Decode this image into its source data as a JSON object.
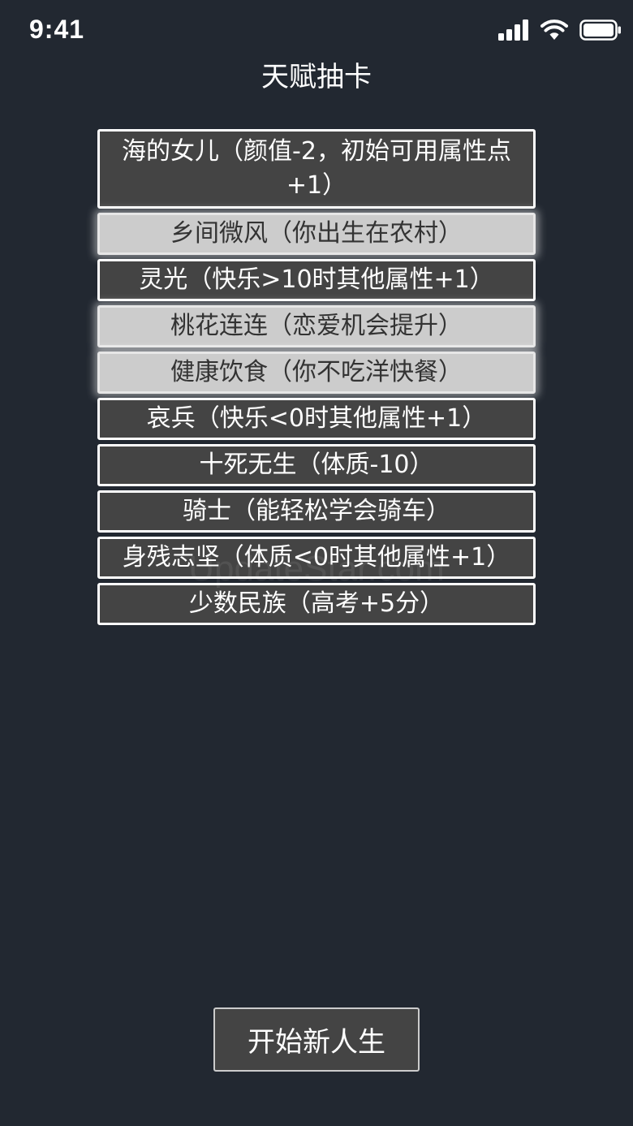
{
  "status_bar": {
    "time": "9:41",
    "icons": [
      "signal-icon",
      "wifi-icon",
      "battery-icon"
    ]
  },
  "page": {
    "title": "天赋抽卡"
  },
  "talents": [
    {
      "label": "海的女儿（颜值-2，初始可用属性点+1）",
      "selected": false
    },
    {
      "label": "乡间微风（你出生在农村）",
      "selected": true
    },
    {
      "label": "灵光（快乐>10时其他属性+1）",
      "selected": false
    },
    {
      "label": "桃花连连（恋爱机会提升）",
      "selected": true
    },
    {
      "label": "健康饮食（你不吃洋快餐）",
      "selected": true
    },
    {
      "label": "哀兵（快乐<0时其他属性+1）",
      "selected": false
    },
    {
      "label": "十死无生（体质-10）",
      "selected": false
    },
    {
      "label": "骑士（能轻松学会骑车）",
      "selected": false
    },
    {
      "label": "身残志坚（体质<0时其他属性+1）",
      "selected": false
    },
    {
      "label": "少数民族（高考+5分）",
      "selected": false
    }
  ],
  "watermark": "UpdateStar.com",
  "actions": {
    "start_label": "开始新人生"
  },
  "colors": {
    "background": "#222831",
    "card": "#444444",
    "card_selected": "#cccccc",
    "border": "#ffffff"
  }
}
